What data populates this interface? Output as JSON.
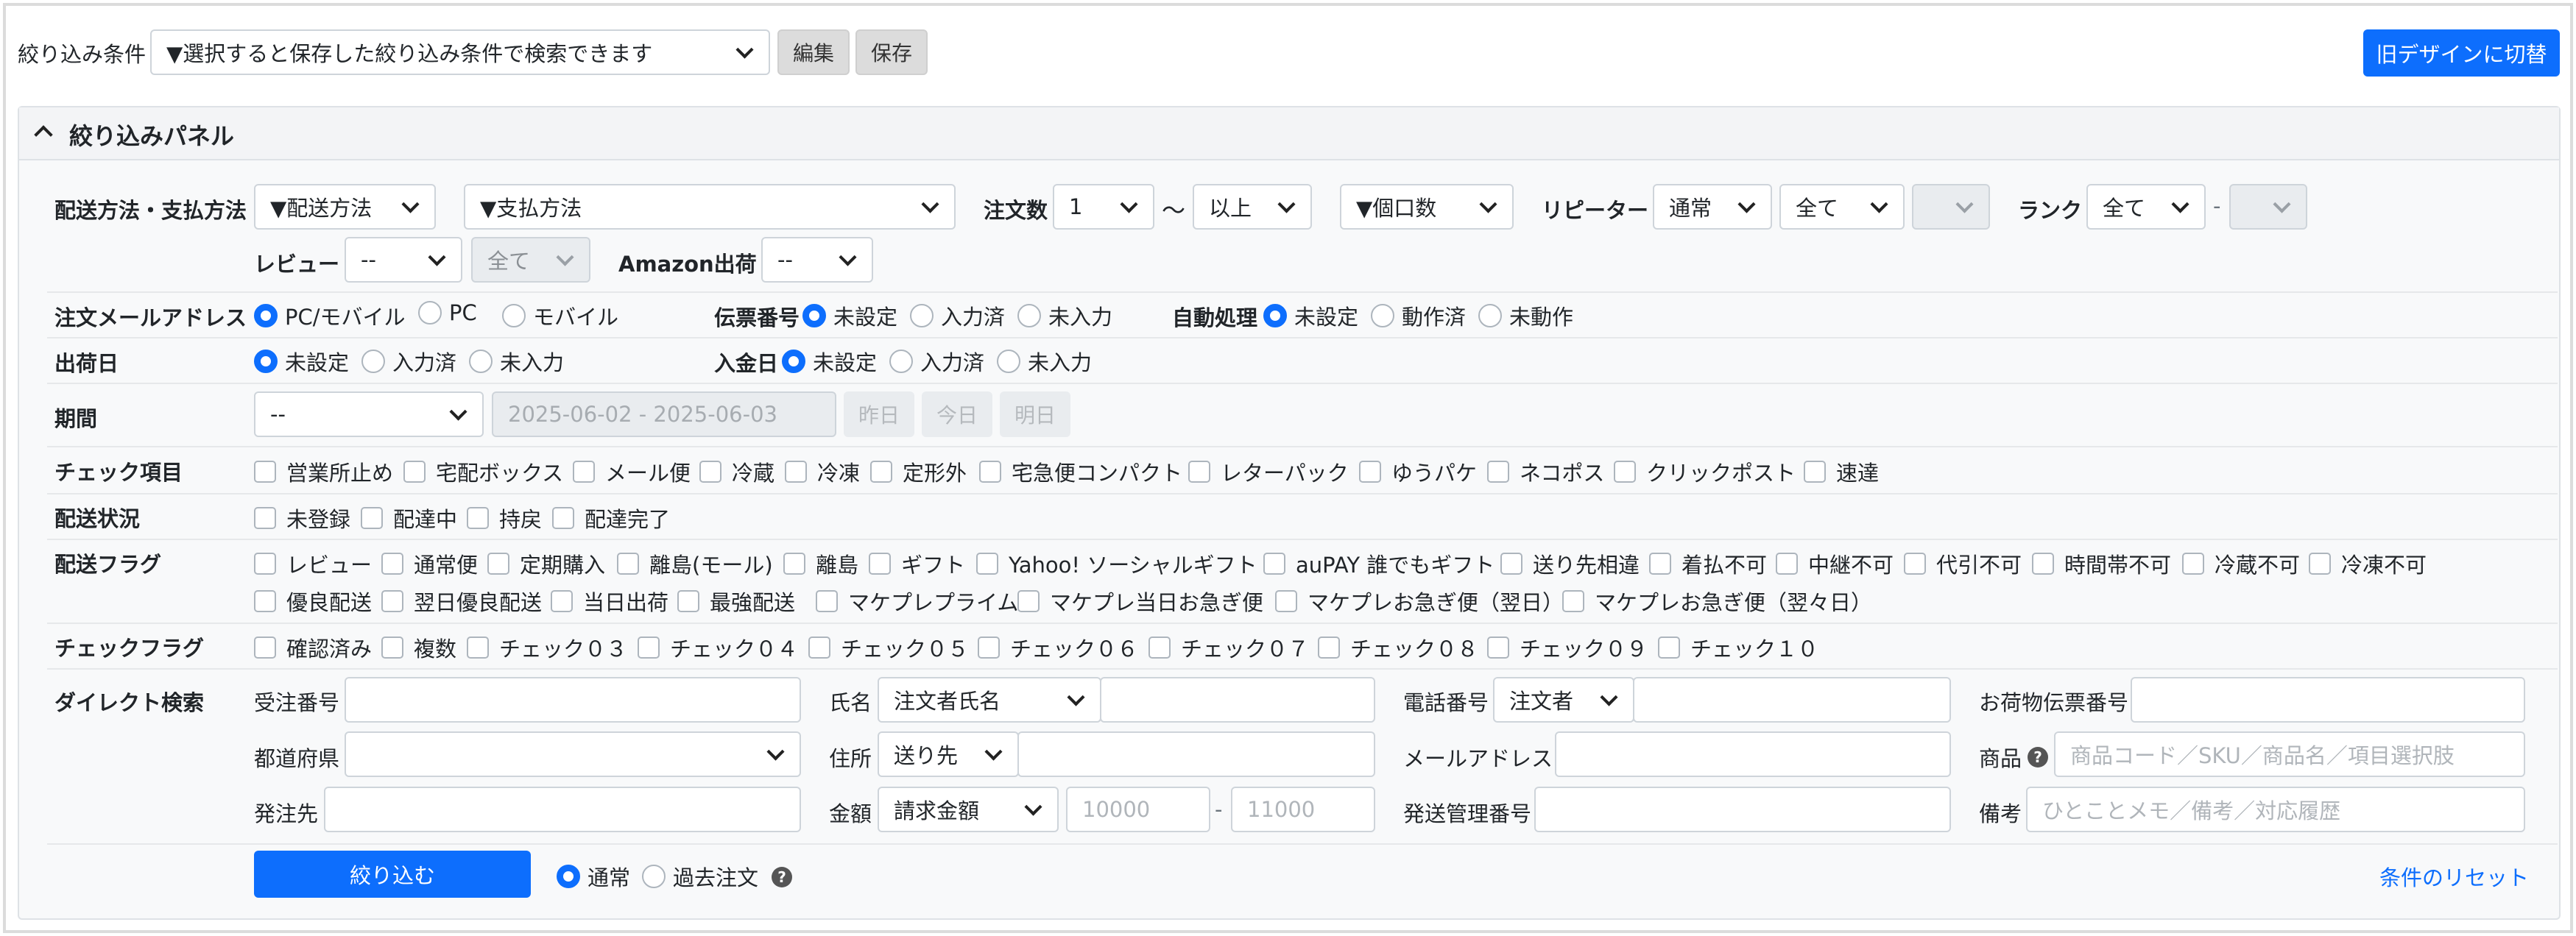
{
  "top": {
    "filter_label": "絞り込み条件",
    "saved_filter_placeholder": "▼選択すると保存した絞り込み条件で検索できます",
    "edit_button": "編集",
    "save_button": "保存",
    "old_design_button": "旧デザインに切替"
  },
  "panel": {
    "title": "絞り込みパネル",
    "shipping_payment": {
      "label": "配送方法・支払方法",
      "shipping_method": "▼配送方法",
      "payment_method": "▼支払方法",
      "order_qty_label": "注文数",
      "order_qty_value": "1",
      "tilde": "〜",
      "order_qty_cond": "以上",
      "parcel_count": "▼個口数",
      "repeater_label": "リピーター",
      "repeater_type": "通常",
      "repeater_scope": "全て",
      "rank_label": "ランク",
      "rank_value": "全て",
      "rank_dash": "-",
      "review_label": "レビュー",
      "review_value": "--",
      "review_scope": "全て",
      "amazon_label": "Amazon出荷",
      "amazon_value": "--"
    },
    "order_email": {
      "label": "注文メールアドレス",
      "options": [
        "PC/モバイル",
        "PC",
        "モバイル"
      ]
    },
    "slip_number": {
      "label": "伝票番号",
      "options": [
        "未設定",
        "入力済",
        "未入力"
      ]
    },
    "auto_process": {
      "label": "自動処理",
      "options": [
        "未設定",
        "動作済",
        "未動作"
      ]
    },
    "ship_date": {
      "label": "出荷日",
      "options": [
        "未設定",
        "入力済",
        "未入力"
      ]
    },
    "payment_date": {
      "label": "入金日",
      "options": [
        "未設定",
        "入力済",
        "未入力"
      ]
    },
    "period": {
      "label": "期間",
      "select_value": "--",
      "date_range": "2025-06-02 - 2025-06-03",
      "yesterday": "昨日",
      "today": "今日",
      "tomorrow": "明日"
    },
    "check_items": {
      "label": "チェック項目",
      "items": [
        "営業所止め",
        "宅配ボックス",
        "メール便",
        "冷蔵",
        "冷凍",
        "定形外",
        "宅急便コンパクト",
        "レターパック",
        "ゆうパケ",
        "ネコポス",
        "クリックポスト",
        "速達"
      ]
    },
    "delivery_status": {
      "label": "配送状況",
      "items": [
        "未登録",
        "配達中",
        "持戻",
        "配達完了"
      ]
    },
    "delivery_flags": {
      "label": "配送フラグ",
      "row1": [
        "レビュー",
        "通常便",
        "定期購入",
        "離島(モール)",
        "離島",
        "ギフト",
        "Yahoo! ソーシャルギフト",
        "auPAY 誰でもギフト",
        "送り先相違",
        "着払不可",
        "中継不可",
        "代引不可",
        "時間帯不可",
        "冷蔵不可",
        "冷凍不可"
      ],
      "row2": [
        "優良配送",
        "翌日優良配送",
        "当日出荷",
        "最強配送",
        "マケプレプライム",
        "マケプレ当日お急ぎ便",
        "マケプレお急ぎ便（翌日）",
        "マケプレお急ぎ便（翌々日）"
      ]
    },
    "check_flags": {
      "label": "チェックフラグ",
      "items": [
        "確認済み",
        "複数",
        "チェック０３",
        "チェック０４",
        "チェック０５",
        "チェック０６",
        "チェック０７",
        "チェック０８",
        "チェック０９",
        "チェック１０"
      ]
    },
    "direct_search": {
      "label": "ダイレクト検索",
      "order_no": "受注番号",
      "name": "氏名",
      "name_type": "注文者氏名",
      "phone": "電話番号",
      "phone_type": "注文者",
      "parcel_slip": "お荷物伝票番号",
      "prefecture": "都道府県",
      "address": "住所",
      "address_type": "送り先",
      "email": "メールアドレス",
      "product": "商品",
      "product_placeholder": "商品コード／SKU／商品名／項目選択肢",
      "vendor": "発注先",
      "amount": "金額",
      "amount_type": "請求金額",
      "amount_min": "10000",
      "amount_dash": "-",
      "amount_max": "11000",
      "ship_mgmt": "発送管理番号",
      "memo": "備考",
      "memo_placeholder": "ひとことメモ／備考／対応履歴"
    },
    "actions": {
      "filter_button": "絞り込む",
      "scope_options": [
        "通常",
        "過去注文"
      ],
      "reset_link": "条件のリセット"
    }
  }
}
